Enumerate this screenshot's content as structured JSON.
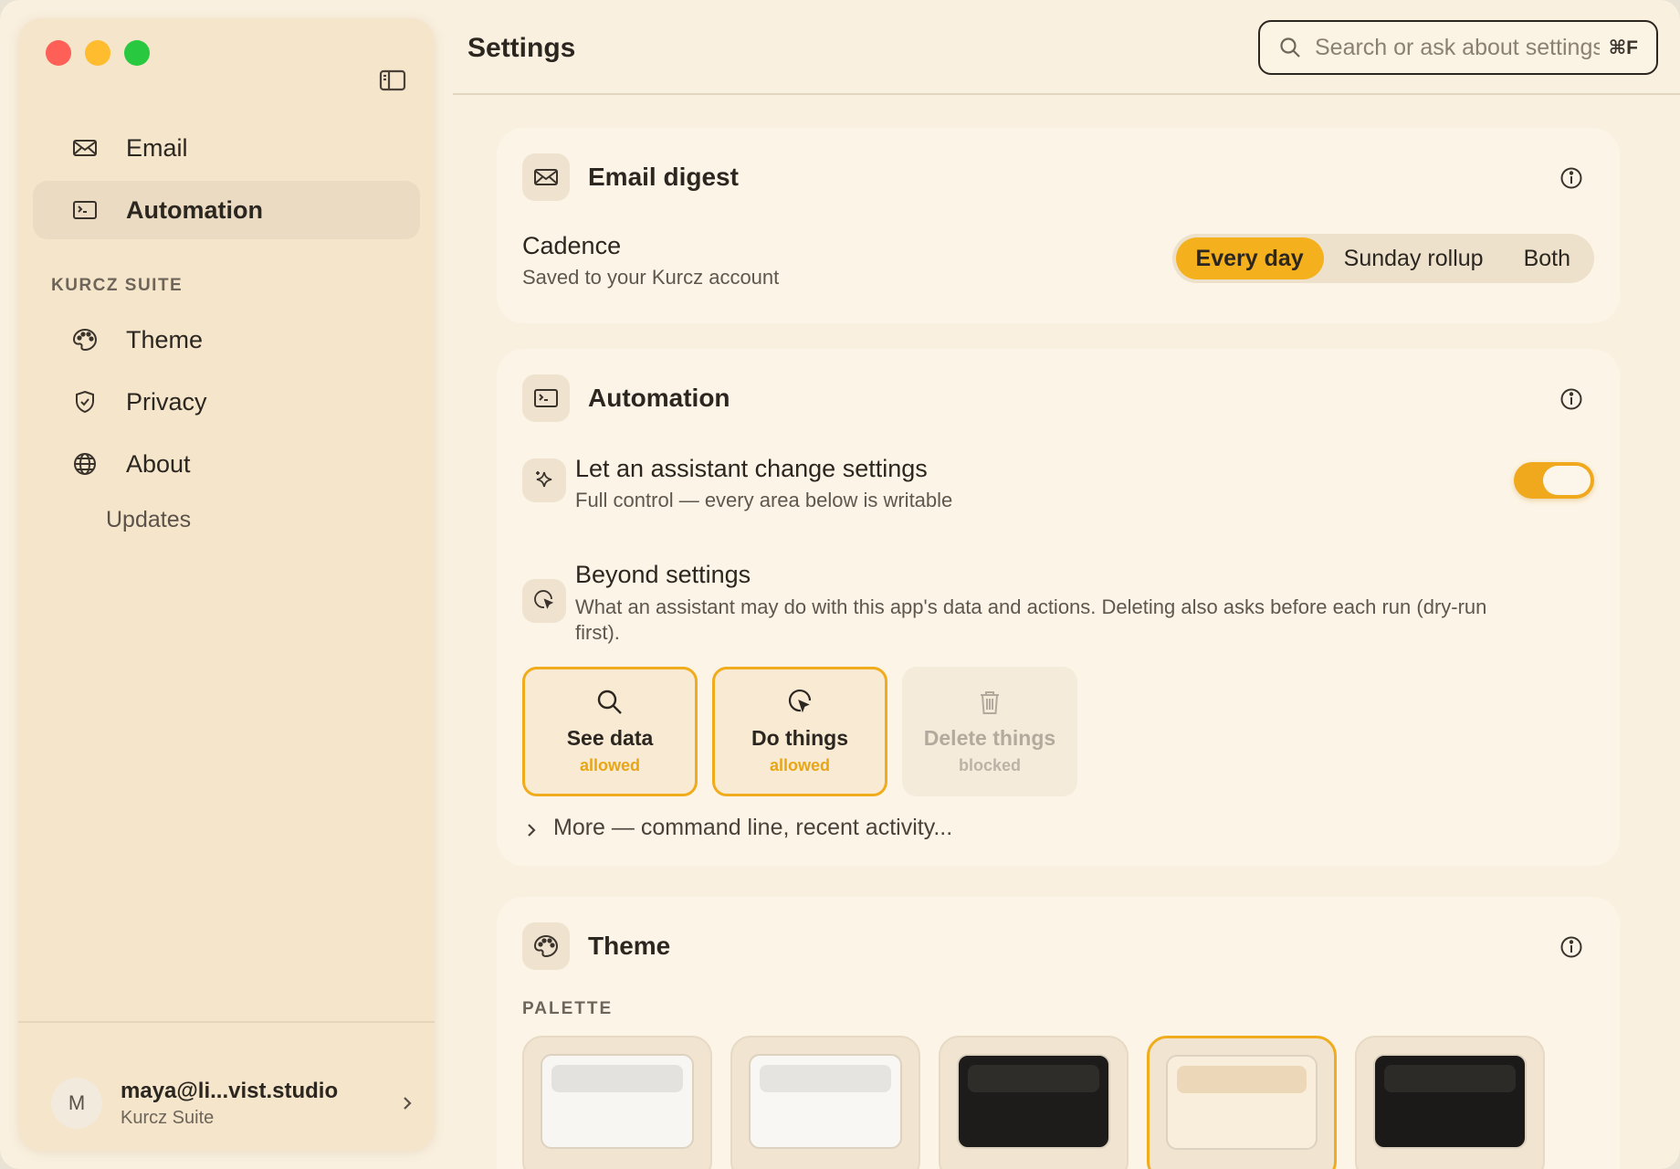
{
  "window": {
    "title": "Settings"
  },
  "sidebar": {
    "items": [
      {
        "label": "Email",
        "icon": "envelope-icon",
        "active": false
      },
      {
        "label": "Automation",
        "icon": "terminal-icon",
        "active": true
      }
    ],
    "section_label": "KURCZ SUITE",
    "suite_items": [
      {
        "label": "Theme",
        "icon": "palette-icon"
      },
      {
        "label": "Privacy",
        "icon": "shield-icon"
      },
      {
        "label": "About",
        "icon": "globe-icon"
      }
    ],
    "sub_items": [
      {
        "label": "Updates"
      }
    ],
    "account": {
      "avatar_initial": "M",
      "email": "maya@li...vist.studio",
      "org": "Kurcz Suite"
    }
  },
  "header": {
    "title": "Settings",
    "search": {
      "placeholder": "Search or ask about settings",
      "shortcut": "⌘F"
    }
  },
  "email_digest": {
    "title": "Email digest",
    "cadence_label": "Cadence",
    "cadence_sub": "Saved to your Kurcz account",
    "options": [
      {
        "label": "Every day",
        "selected": true
      },
      {
        "label": "Sunday rollup",
        "selected": false
      },
      {
        "label": "Both",
        "selected": false
      }
    ]
  },
  "automation": {
    "title": "Automation",
    "assistant_label": "Let an assistant change settings",
    "assistant_sub": "Full control — every area below is writable",
    "assistant_enabled": true,
    "beyond_label": "Beyond settings",
    "beyond_sub": "What an assistant may do with this app's data and actions. Deleting also asks before each run (dry-run first).",
    "permissions": [
      {
        "label": "See data",
        "state": "allowed",
        "icon": "search-icon"
      },
      {
        "label": "Do things",
        "state": "allowed",
        "icon": "cursor-click-icon"
      },
      {
        "label": "Delete things",
        "state": "blocked",
        "icon": "trash-icon"
      }
    ],
    "more_label": "More — command line, recent activity..."
  },
  "theme": {
    "title": "Theme",
    "palette_label": "PALETTE",
    "swatches": [
      {
        "bg": "#f8f6f2",
        "bar": "#e4e2df",
        "selected": false
      },
      {
        "bg": "#f9f7f3",
        "bar": "#e6e4e1",
        "selected": false
      },
      {
        "bg": "#1e1c1a",
        "bar": "#2f2d2a",
        "selected": false
      },
      {
        "bg": "#f9eedc",
        "bar": "#ecd8b8",
        "selected": true
      },
      {
        "bg": "#1c1a18",
        "bar": "#2d2b28",
        "selected": false
      }
    ]
  },
  "colors": {
    "accent": "#f4b11d",
    "sidebar_bg": "#f4e5cb",
    "content_bg": "#faf0df"
  }
}
